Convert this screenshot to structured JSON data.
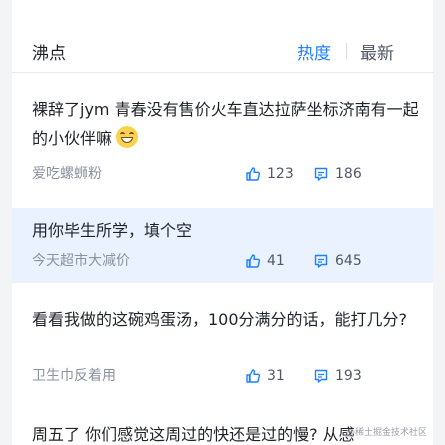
{
  "header": {
    "title": "沸点",
    "sort_hot": "热度",
    "sort_new": "最新"
  },
  "posts": [
    {
      "title": "裸辞了jym 青春没有售价火车直达拉萨坐标济南有一起的小伙伴嘛",
      "emoji": "grinning-face-icon",
      "author": "爱吃螺蛳粉",
      "likes": "123",
      "comments": "186"
    },
    {
      "title": "用你毕生所学，填个空",
      "author": "今天超市大减价",
      "likes": "41",
      "comments": "645"
    },
    {
      "title": "看看我做的这碗鸡蛋汤，100分满分的话，能打几分?",
      "author": "卫生巾反着用",
      "likes": "31",
      "comments": "193"
    },
    {
      "title": "周五了 你们感觉这周过的快还是过的慢? 从感"
    }
  ],
  "icons": {
    "like": "thumbs-up-icon",
    "comment": "comment-icon"
  },
  "colors": {
    "accent": "#1e80ff",
    "highlight_bg": "#eaf2ff"
  },
  "watermark": "@稀土掘金技术社区"
}
